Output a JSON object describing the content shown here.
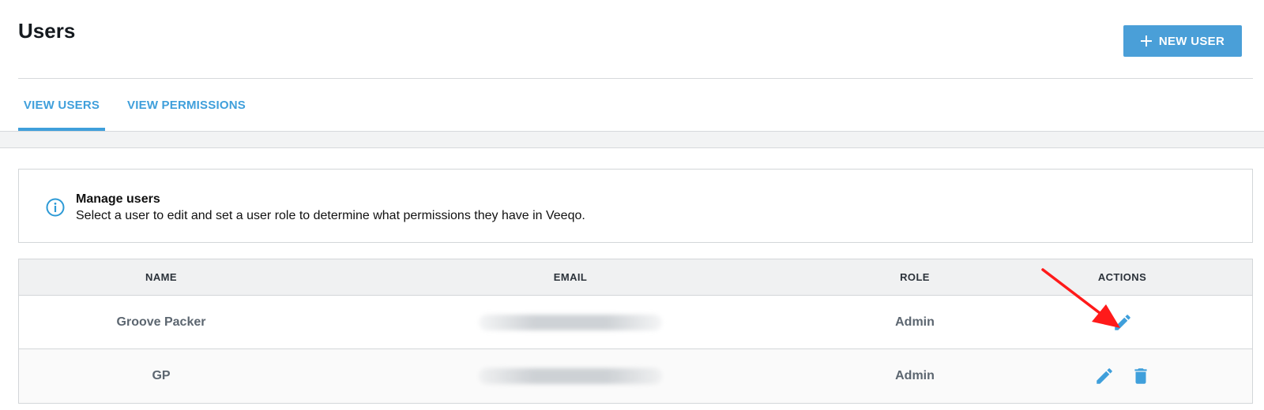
{
  "header": {
    "title": "Users",
    "new_user_label": "NEW USER"
  },
  "tabs": [
    {
      "label": "VIEW USERS",
      "active": true
    },
    {
      "label": "VIEW PERMISSIONS",
      "active": false
    }
  ],
  "info": {
    "icon": "info-icon",
    "title": "Manage users",
    "description": "Select a user to edit and set a user role to determine what permissions they have in Veeqo."
  },
  "table": {
    "columns": [
      "NAME",
      "EMAIL",
      "ROLE",
      "ACTIONS"
    ],
    "rows": [
      {
        "name": "Groove Packer",
        "role": "Admin",
        "actions": [
          "edit-icon"
        ]
      },
      {
        "name": "GP",
        "role": "Admin",
        "actions": [
          "edit-icon",
          "trash-icon"
        ]
      }
    ]
  },
  "colors": {
    "accent": "#4a9fd8",
    "annotation_arrow": "#ff1a1a"
  }
}
